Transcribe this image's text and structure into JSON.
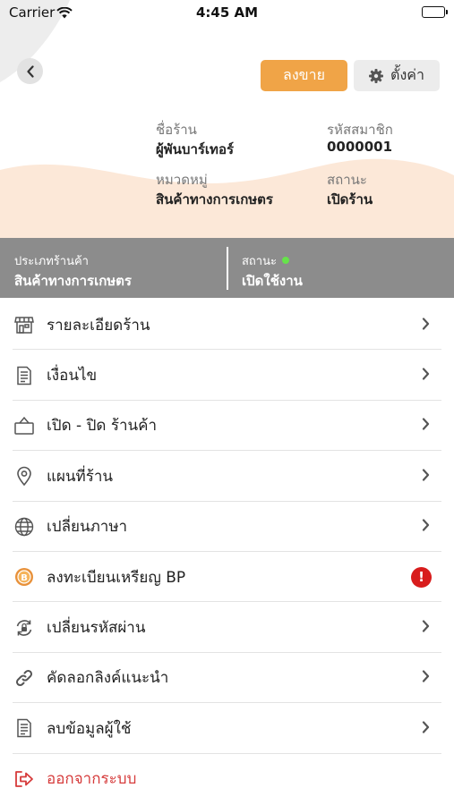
{
  "status_bar": {
    "carrier": "Carrier",
    "time": "4:45 AM"
  },
  "header": {
    "sell_label": "ลงขาย",
    "settings_label": "ตั้งค่า"
  },
  "shop_info": {
    "name_label": "ชื่อร้าน",
    "name_value": "ผู้พันบาร์เทอร์",
    "member_label": "รหัสสมาชิก",
    "member_value": "0000001",
    "category_label": "หมวดหมู่",
    "category_value": "สินค้าทางการเกษตร",
    "status_label": "สถานะ",
    "status_value": "เปิดร้าน"
  },
  "band": {
    "type_label": "ประเภทร้านค้า",
    "type_value": "สินค้าทางการเกษตร",
    "status_label": "สถานะ",
    "status_value": "เปิดใช้งาน"
  },
  "menu": {
    "items": [
      {
        "label": "รายละเอียดร้าน",
        "icon": "store-icon"
      },
      {
        "label": "เงื่อนไข",
        "icon": "document-icon"
      },
      {
        "label": "เปิด - ปิด ร้านค้า",
        "icon": "basket-icon"
      },
      {
        "label": "แผนที่ร้าน",
        "icon": "map-pin-icon"
      },
      {
        "label": "เปลี่ยนภาษา",
        "icon": "globe-icon"
      },
      {
        "label": "ลงทะเบียนเหรียญ BP",
        "icon": "coin-icon",
        "badge": "!"
      },
      {
        "label": "เปลี่ยนรหัสผ่าน",
        "icon": "refresh-lock-icon"
      },
      {
        "label": "คัดลอกลิงค์แนะนำ",
        "icon": "link-icon"
      },
      {
        "label": "ลบข้อมูลผู้ใช้",
        "icon": "delete-document-icon"
      },
      {
        "label": "ออกจากระบบ",
        "icon": "logout-icon"
      }
    ]
  },
  "colors": {
    "accent": "#f0a447",
    "band": "#8c8c8c",
    "danger": "#d81c1c",
    "logout": "#d63b3b",
    "status_dot": "#66e34a"
  }
}
